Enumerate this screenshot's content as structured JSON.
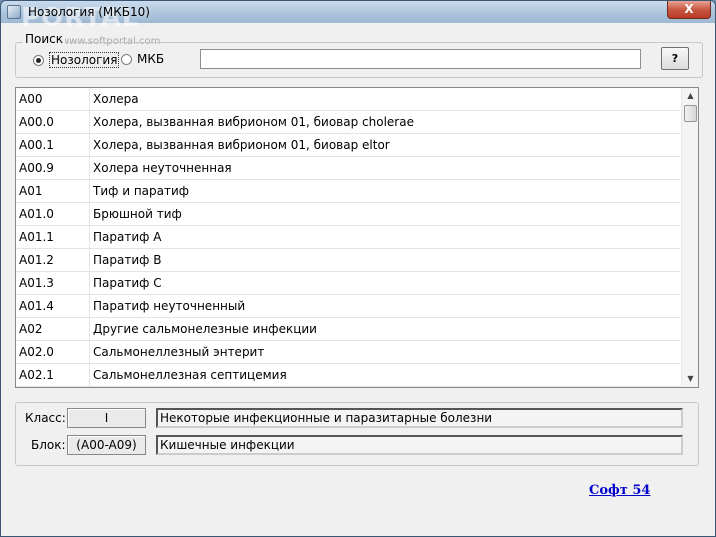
{
  "window": {
    "title": "Нозология (МКБ10)",
    "close_label": "X",
    "watermark": "PORTAL",
    "watermark_sub": "www.softportal.com"
  },
  "search": {
    "legend": "Поиск",
    "options": [
      {
        "label": "Нозология",
        "selected": true
      },
      {
        "label": "МКБ",
        "selected": false
      }
    ],
    "input_value": "",
    "help_label": "?"
  },
  "list": {
    "rows": [
      {
        "code": "A00",
        "name": "Холера"
      },
      {
        "code": "A00.0",
        "name": "Холера, вызванная вибрионом 01, биовар cholerae"
      },
      {
        "code": "A00.1",
        "name": "Холера, вызванная вибрионом 01, биовар eltor"
      },
      {
        "code": "A00.9",
        "name": "Холера неуточненная"
      },
      {
        "code": "A01",
        "name": "Тиф и паратиф"
      },
      {
        "code": "A01.0",
        "name": "Брюшной тиф"
      },
      {
        "code": "A01.1",
        "name": "Паратиф A"
      },
      {
        "code": "A01.2",
        "name": "Паратиф B"
      },
      {
        "code": "A01.3",
        "name": "Паратиф C"
      },
      {
        "code": "A01.4",
        "name": "Паратиф неуточненный"
      },
      {
        "code": "A02",
        "name": "Другие сальмонелезные инфекции"
      },
      {
        "code": "A02.0",
        "name": "Сальмонеллезный энтерит"
      },
      {
        "code": "A02.1",
        "name": "Сальмонеллезная септицемия"
      }
    ]
  },
  "info": {
    "class_label": "Класс:",
    "class_code": "I",
    "class_value": "Некоторые инфекционные и паразитарные болезни",
    "block_label": "Блок:",
    "block_code": "(A00-A09)",
    "block_value": "Кишечные инфекции"
  },
  "footer": {
    "link_label": "Софт 54"
  },
  "colors": {
    "link": "#0000cc",
    "close_button": "#c75742"
  }
}
